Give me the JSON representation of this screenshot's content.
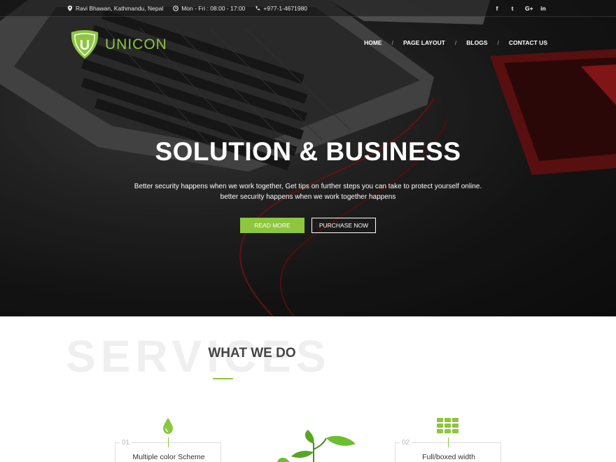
{
  "topbar": {
    "address": "Ravi Bhawan, Kathmandu, Nepal",
    "hours": "Mon - Fri : 08:00 - 17:00",
    "phone": "+977-1-4671980",
    "social": [
      "f",
      "t",
      "G+",
      "in"
    ]
  },
  "brand": {
    "logo_letter": "U",
    "name": "UNICON",
    "accent_color": "#8dc63f"
  },
  "nav": {
    "items": [
      "HOME",
      "PAGE LAYOUT",
      "BLOGS",
      "CONTACT US"
    ],
    "separator": "/"
  },
  "hero": {
    "title": "SOLUTION & BUSINESS",
    "text": "Better security happens when we work together, Get tips on further steps you can take to protect yourself online. better security happens when we work together happens",
    "primary_button": "READ MORE",
    "secondary_button": "PURCHASE NOW"
  },
  "services": {
    "background_word": "SERVICES",
    "heading": "WHAT WE DO",
    "cards": [
      {
        "number": "01",
        "title": "Multiple color Scheme",
        "icon": "drop-icon"
      },
      {
        "number": "02",
        "title": "Full/boxed width",
        "icon": "grid-icon"
      }
    ],
    "center_image": "plant-sprout"
  }
}
